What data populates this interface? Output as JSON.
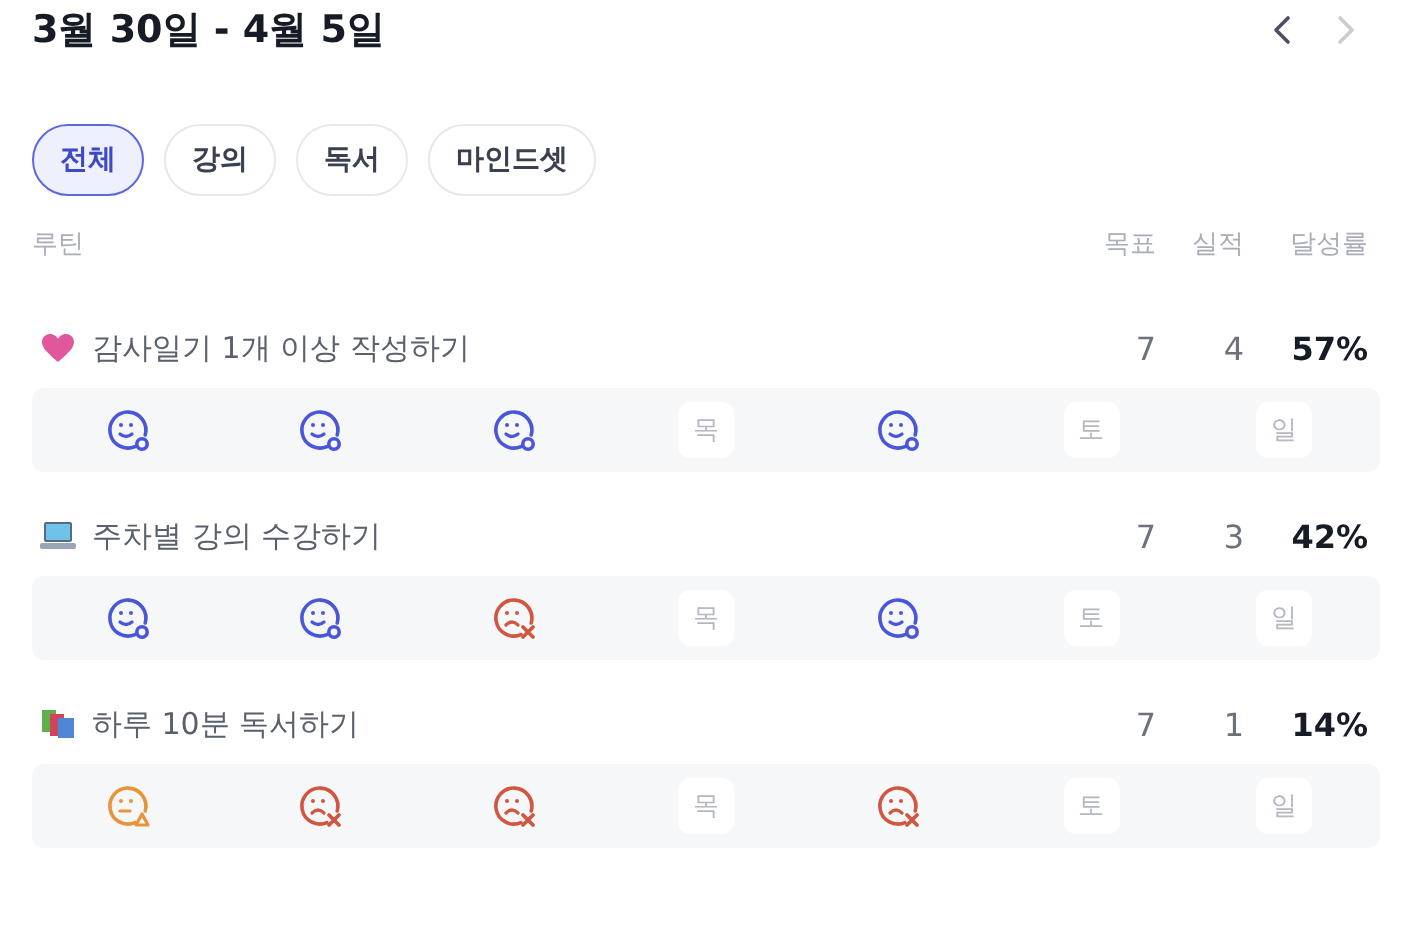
{
  "header": {
    "title": "3월 30일 - 4월 5일"
  },
  "nav": [
    {
      "kind": "prev",
      "disabled": false
    },
    {
      "kind": "next",
      "disabled": true
    }
  ],
  "filters": [
    {
      "label": "전체",
      "selected": true
    },
    {
      "label": "강의",
      "selected": false
    },
    {
      "label": "독서",
      "selected": false
    },
    {
      "label": "마인드셋",
      "selected": false
    }
  ],
  "columns": {
    "routine": "루틴",
    "goal": "목표",
    "actual": "실적",
    "rate": "달성률"
  },
  "routines": [
    {
      "kind": "heart",
      "title": "감사일기 1개 이상 작성하기",
      "goal": "7",
      "actual": "4",
      "rate": "57%",
      "days": [
        {
          "kind": "done"
        },
        {
          "kind": "done"
        },
        {
          "kind": "done"
        },
        {
          "kind": "empty",
          "label": "목"
        },
        {
          "kind": "done"
        },
        {
          "kind": "empty",
          "label": "토"
        },
        {
          "kind": "empty",
          "label": "일"
        }
      ]
    },
    {
      "kind": "laptop",
      "title": "주차별 강의 수강하기",
      "goal": "7",
      "actual": "3",
      "rate": "42%",
      "days": [
        {
          "kind": "done"
        },
        {
          "kind": "done"
        },
        {
          "kind": "fail"
        },
        {
          "kind": "empty",
          "label": "목"
        },
        {
          "kind": "done"
        },
        {
          "kind": "empty",
          "label": "토"
        },
        {
          "kind": "empty",
          "label": "일"
        }
      ]
    },
    {
      "kind": "books",
      "title": "하루 10분 독서하기",
      "goal": "7",
      "actual": "1",
      "rate": "14%",
      "days": [
        {
          "kind": "partial"
        },
        {
          "kind": "fail"
        },
        {
          "kind": "fail"
        },
        {
          "kind": "empty",
          "label": "목"
        },
        {
          "kind": "fail"
        },
        {
          "kind": "empty",
          "label": "토"
        },
        {
          "kind": "empty",
          "label": "일"
        }
      ]
    }
  ]
}
